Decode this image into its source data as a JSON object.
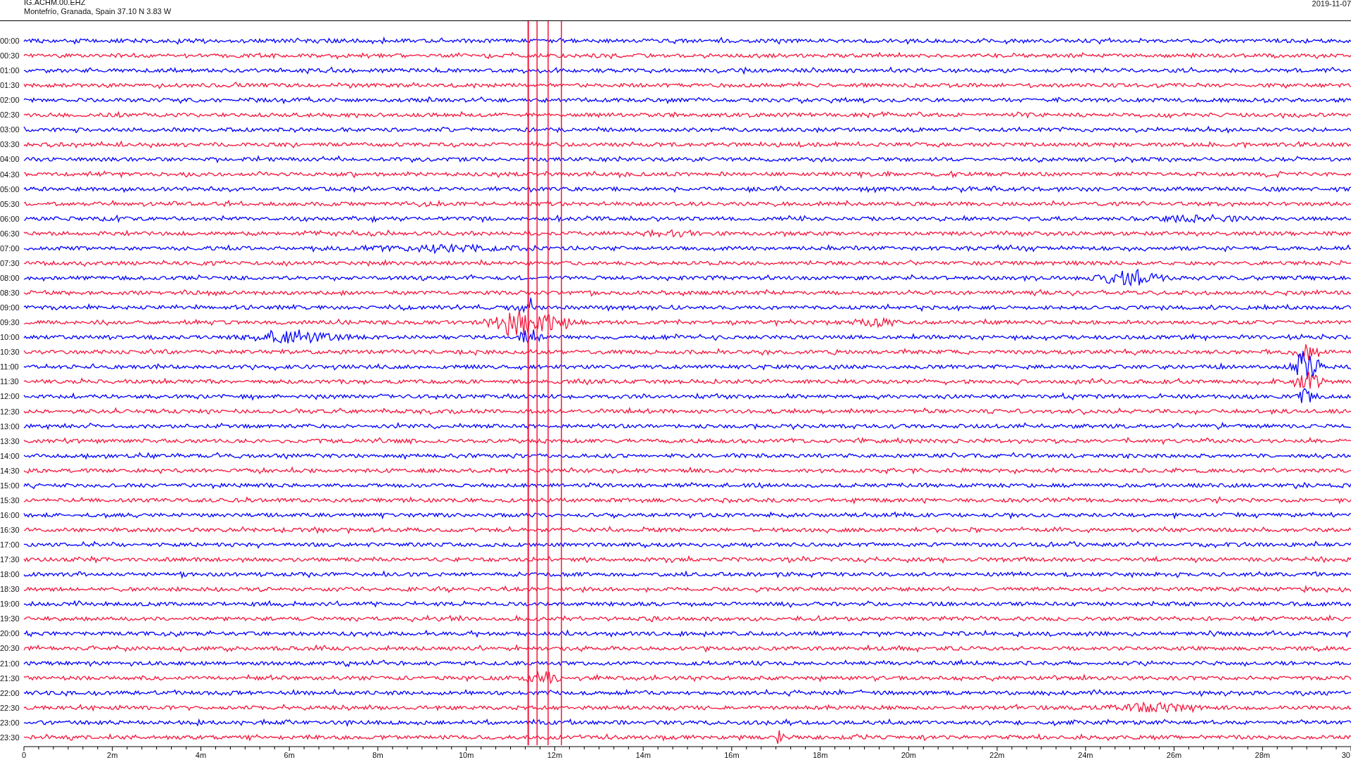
{
  "header": {
    "station": "IG.ACHM.00.EHZ",
    "location": "Montefrío, Granada, Spain  37.10 N 3.83 W",
    "date": "2019-11-07"
  },
  "rows": [
    {
      "label": "00:00",
      "color": "#0000ff"
    },
    {
      "label": "00:30",
      "color": "#f5163c"
    },
    {
      "label": "01:00",
      "color": "#0000ff"
    },
    {
      "label": "01:30",
      "color": "#f5163c"
    },
    {
      "label": "02:00",
      "color": "#0000ff"
    },
    {
      "label": "02:30",
      "color": "#f5163c"
    },
    {
      "label": "03:00",
      "color": "#0000ff"
    },
    {
      "label": "03:30",
      "color": "#f5163c"
    },
    {
      "label": "04:00",
      "color": "#0000ff"
    },
    {
      "label": "04:30",
      "color": "#f5163c"
    },
    {
      "label": "05:00",
      "color": "#0000ff"
    },
    {
      "label": "05:30",
      "color": "#f5163c"
    },
    {
      "label": "06:00",
      "color": "#0000ff"
    },
    {
      "label": "06:30",
      "color": "#f5163c"
    },
    {
      "label": "07:00",
      "color": "#0000ff"
    },
    {
      "label": "07:30",
      "color": "#f5163c"
    },
    {
      "label": "08:00",
      "color": "#0000ff"
    },
    {
      "label": "08:30",
      "color": "#f5163c"
    },
    {
      "label": "09:00",
      "color": "#0000ff"
    },
    {
      "label": "09:30",
      "color": "#f5163c"
    },
    {
      "label": "10:00",
      "color": "#0000ff"
    },
    {
      "label": "10:30",
      "color": "#f5163c"
    },
    {
      "label": "11:00",
      "color": "#0000ff"
    },
    {
      "label": "11:30",
      "color": "#f5163c"
    },
    {
      "label": "12:00",
      "color": "#0000ff"
    },
    {
      "label": "12:30",
      "color": "#f5163c"
    },
    {
      "label": "13:00",
      "color": "#0000ff"
    },
    {
      "label": "13:30",
      "color": "#f5163c"
    },
    {
      "label": "14:00",
      "color": "#0000ff"
    },
    {
      "label": "14:30",
      "color": "#f5163c"
    },
    {
      "label": "15:00",
      "color": "#0000ff"
    },
    {
      "label": "15:30",
      "color": "#f5163c"
    },
    {
      "label": "16:00",
      "color": "#0000ff"
    },
    {
      "label": "16:30",
      "color": "#f5163c"
    },
    {
      "label": "17:00",
      "color": "#0000ff"
    },
    {
      "label": "17:30",
      "color": "#f5163c"
    },
    {
      "label": "18:00",
      "color": "#0000ff"
    },
    {
      "label": "18:30",
      "color": "#f5163c"
    },
    {
      "label": "19:00",
      "color": "#0000ff"
    },
    {
      "label": "19:30",
      "color": "#f5163c"
    },
    {
      "label": "20:00",
      "color": "#0000ff"
    },
    {
      "label": "20:30",
      "color": "#f5163c"
    },
    {
      "label": "21:00",
      "color": "#0000ff"
    },
    {
      "label": "21:30",
      "color": "#f5163c"
    },
    {
      "label": "22:00",
      "color": "#0000ff"
    },
    {
      "label": "22:30",
      "color": "#f5163c"
    },
    {
      "label": "23:00",
      "color": "#0000ff"
    },
    {
      "label": "23:30",
      "color": "#f5163c"
    }
  ],
  "axis": {
    "ticks": [
      "0",
      "2m",
      "4m",
      "6m",
      "8m",
      "10m",
      "12m",
      "14m",
      "16m",
      "18m",
      "20m",
      "22m",
      "24m",
      "26m",
      "28m",
      "30"
    ]
  }
}
